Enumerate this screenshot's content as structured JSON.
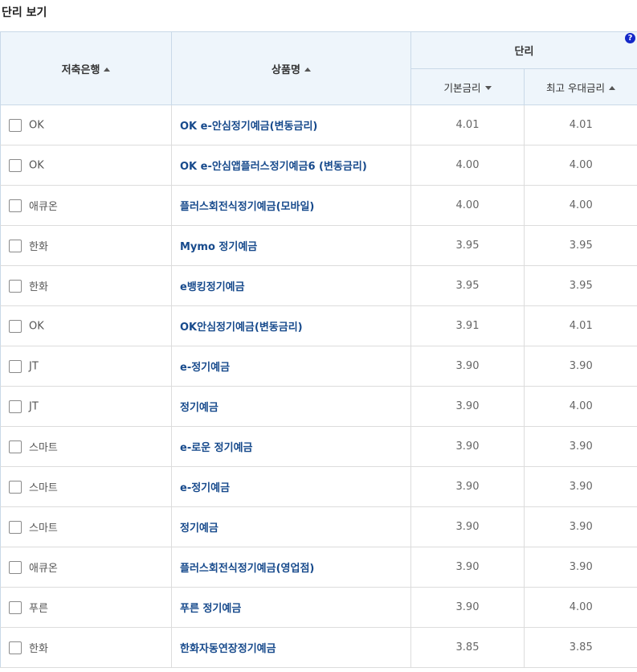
{
  "page_title": "단리 보기",
  "header": {
    "bank": "저축은행",
    "product": "상품명",
    "simple_rate": "단리",
    "help": "?",
    "base_rate": "기본금리",
    "max_rate": "최고 우대금리"
  },
  "rows": [
    {
      "bank": "OK",
      "product": "OK e-안심정기예금(변동금리)",
      "base": "4.01",
      "max": "4.01"
    },
    {
      "bank": "OK",
      "product": "OK e-안심앱플러스정기예금6 (변동금리)",
      "base": "4.00",
      "max": "4.00"
    },
    {
      "bank": "애큐온",
      "product": "플러스회전식정기예금(모바일)",
      "base": "4.00",
      "max": "4.00"
    },
    {
      "bank": "한화",
      "product": "Mymo 정기예금",
      "base": "3.95",
      "max": "3.95"
    },
    {
      "bank": "한화",
      "product": "e뱅킹정기예금",
      "base": "3.95",
      "max": "3.95"
    },
    {
      "bank": "OK",
      "product": "OK안심정기예금(변동금리)",
      "base": "3.91",
      "max": "4.01"
    },
    {
      "bank": "JT",
      "product": "e-정기예금",
      "base": "3.90",
      "max": "3.90"
    },
    {
      "bank": "JT",
      "product": "정기예금",
      "base": "3.90",
      "max": "4.00"
    },
    {
      "bank": "스마트",
      "product": "e-로운 정기예금",
      "base": "3.90",
      "max": "3.90"
    },
    {
      "bank": "스마트",
      "product": "e-정기예금",
      "base": "3.90",
      "max": "3.90"
    },
    {
      "bank": "스마트",
      "product": "정기예금",
      "base": "3.90",
      "max": "3.90"
    },
    {
      "bank": "애큐온",
      "product": "플러스회전식정기예금(영업점)",
      "base": "3.90",
      "max": "3.90"
    },
    {
      "bank": "푸른",
      "product": "푸른 정기예금",
      "base": "3.90",
      "max": "4.00"
    },
    {
      "bank": "한화",
      "product": "한화자동연장정기예금",
      "base": "3.85",
      "max": "3.85"
    }
  ]
}
